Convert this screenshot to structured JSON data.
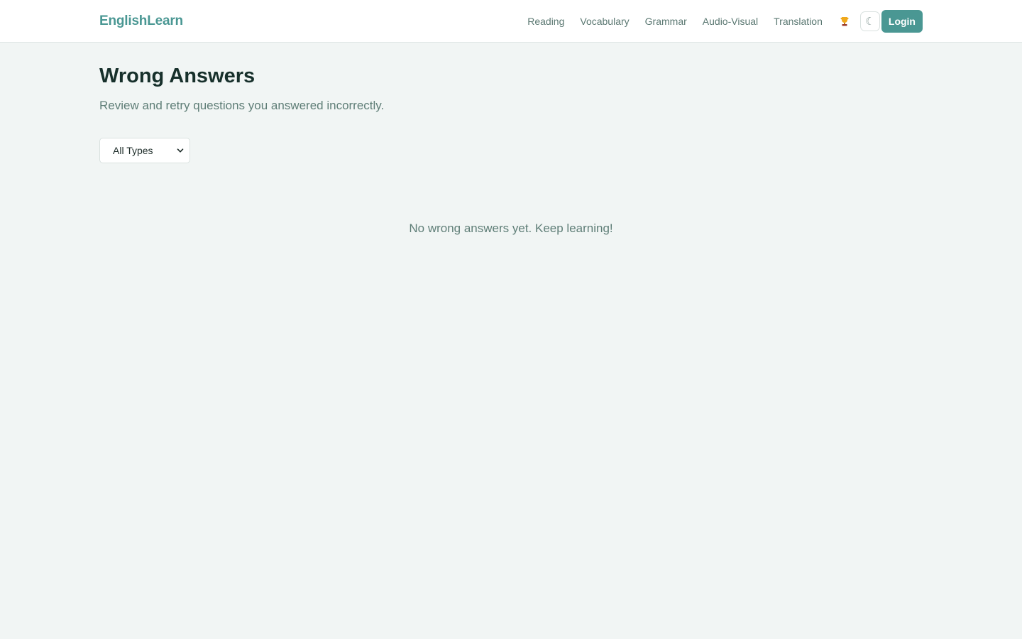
{
  "header": {
    "brand": "EnglishLearn",
    "nav": [
      {
        "label": "Reading"
      },
      {
        "label": "Vocabulary"
      },
      {
        "label": "Grammar"
      },
      {
        "label": "Audio-Visual"
      },
      {
        "label": "Translation"
      }
    ],
    "trophy_icon": "trophy-icon",
    "theme_icon": "☾",
    "login_label": "Login"
  },
  "main": {
    "title": "Wrong Answers",
    "subtitle": "Review and retry questions you answered incorrectly.",
    "filter": {
      "selected": "All Types"
    },
    "empty_message": "No wrong answers yet. Keep learning!"
  },
  "colors": {
    "accent": "#4a9793",
    "background": "#f1f5f4",
    "muted_text": "#5f7e77",
    "heading": "#17302b"
  }
}
